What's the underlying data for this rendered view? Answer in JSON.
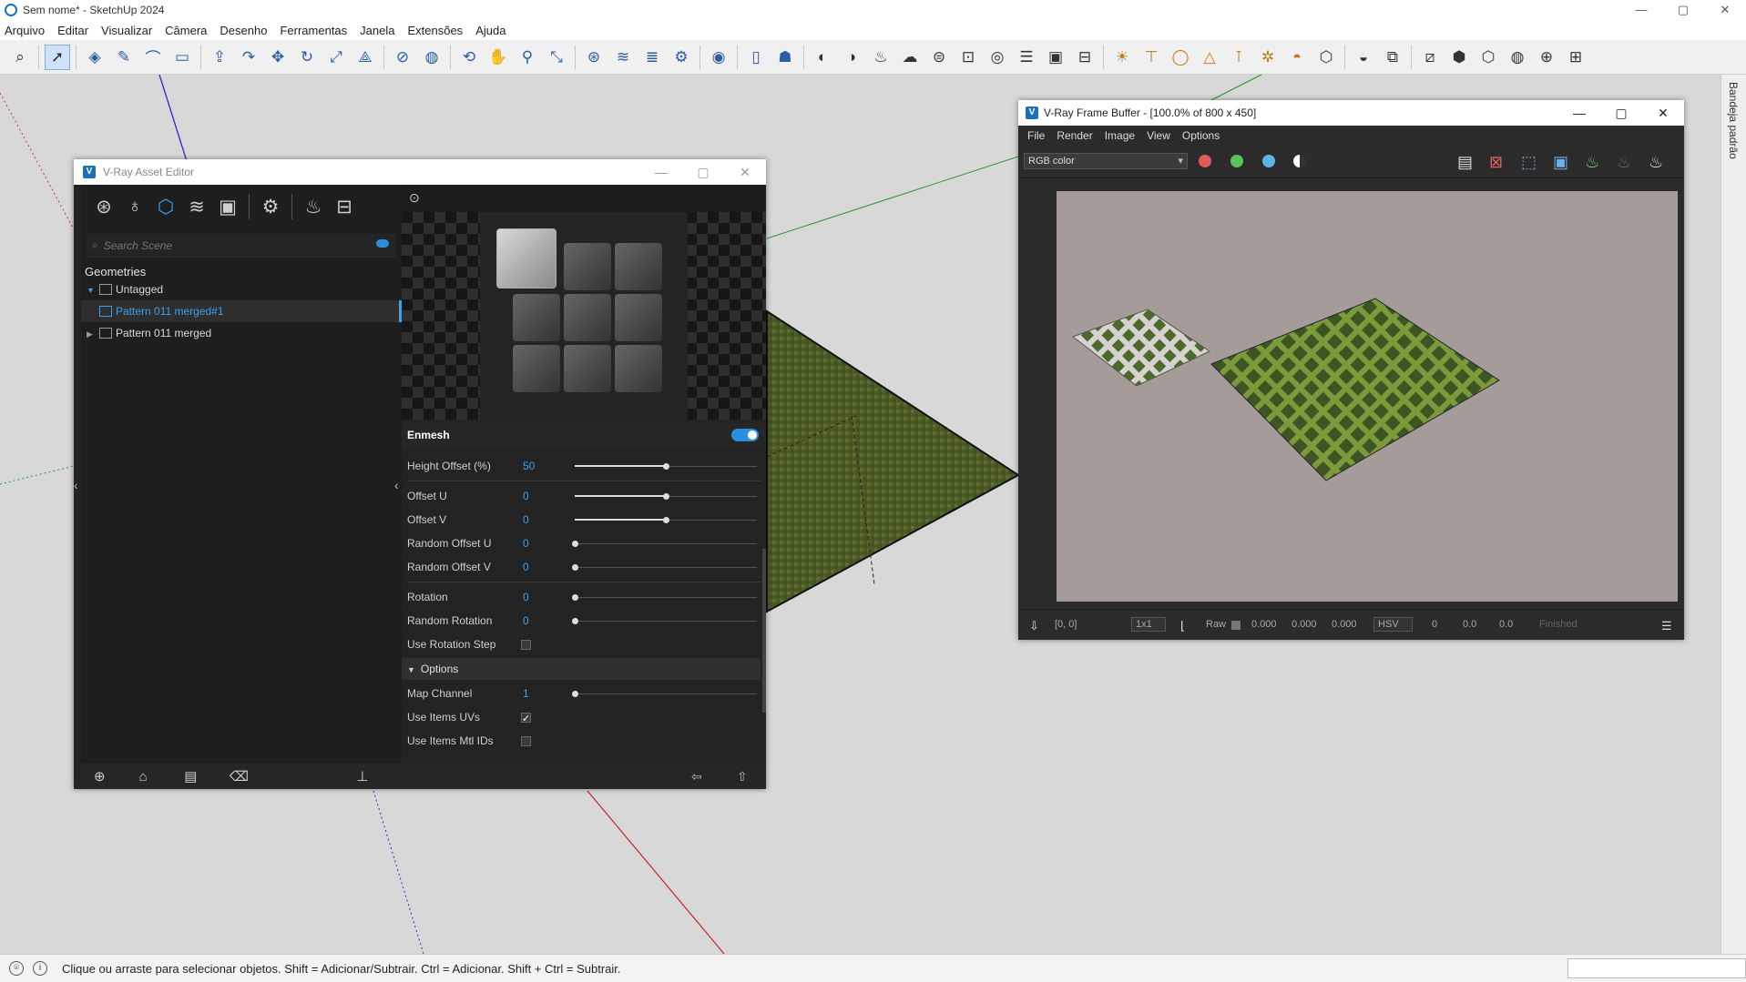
{
  "window": {
    "title": "Sem nome* - SketchUp 2024",
    "controls": [
      "—",
      "▢",
      "✕"
    ]
  },
  "menu": [
    "Arquivo",
    "Editar",
    "Visualizar",
    "Câmera",
    "Desenho",
    "Ferramentas",
    "Janela",
    "Extensões",
    "Ajuda"
  ],
  "tray": {
    "label": "Bandeja padrão"
  },
  "status": {
    "text": "Clique ou arraste para selecionar objetos. Shift = Adicionar/Subtrair. Ctrl = Adicionar. Shift + Ctrl = Subtrair."
  },
  "asset_editor": {
    "title": "V-Ray Asset Editor",
    "search_placeholder": "Search Scene",
    "group": "Geometries",
    "items": [
      {
        "label": "Untagged"
      },
      {
        "label": "Pattern 011 merged#1"
      },
      {
        "label": "Pattern 011 merged"
      }
    ],
    "enmesh": {
      "label": "Enmesh",
      "enabled": true
    },
    "props": {
      "height_offset": {
        "label": "Height Offset (%)",
        "value": "50",
        "level": 0.5
      },
      "offset_u": {
        "label": "Offset U",
        "value": "0",
        "level": 0.5
      },
      "offset_v": {
        "label": "Offset V",
        "value": "0",
        "level": 0.5
      },
      "random_offset_u": {
        "label": "Random Offset U",
        "value": "0",
        "level": 0
      },
      "random_offset_v": {
        "label": "Random Offset V",
        "value": "0",
        "level": 0
      },
      "rotation": {
        "label": "Rotation",
        "value": "0",
        "level": 0
      },
      "random_rotation": {
        "label": "Random Rotation",
        "value": "0",
        "level": 0
      },
      "use_rotation_step": {
        "label": "Use Rotation Step",
        "checked": false
      },
      "options_section": "Options",
      "map_channel": {
        "label": "Map Channel",
        "value": "1",
        "level": 0
      },
      "use_items_uvs": {
        "label": "Use Items UVs",
        "checked": true
      },
      "use_items_mtl_ids": {
        "label": "Use Items Mtl IDs",
        "checked": false
      }
    }
  },
  "vfb": {
    "title": "V-Ray Frame Buffer - [100.0% of 800 x 450]",
    "menu": [
      "File",
      "Render",
      "Image",
      "View",
      "Options"
    ],
    "channel": "RGB color",
    "status": {
      "coords": "[0, 0]",
      "ratio": "1x1",
      "raw": "Raw",
      "r": "0.000",
      "g": "0.000",
      "b": "0.000",
      "mode": "HSV",
      "h": "0",
      "s": "0.0",
      "v": "0.0",
      "state": "Finished"
    }
  }
}
